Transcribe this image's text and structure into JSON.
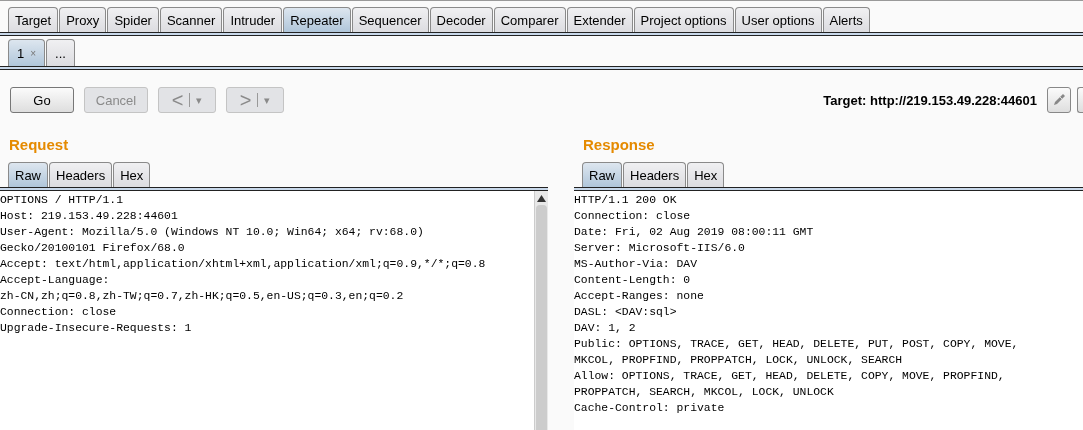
{
  "main_tabs": [
    {
      "label": "Target",
      "selected": false
    },
    {
      "label": "Proxy",
      "selected": false
    },
    {
      "label": "Spider",
      "selected": false
    },
    {
      "label": "Scanner",
      "selected": false
    },
    {
      "label": "Intruder",
      "selected": false
    },
    {
      "label": "Repeater",
      "selected": true
    },
    {
      "label": "Sequencer",
      "selected": false
    },
    {
      "label": "Decoder",
      "selected": false
    },
    {
      "label": "Comparer",
      "selected": false
    },
    {
      "label": "Extender",
      "selected": false
    },
    {
      "label": "Project options",
      "selected": false
    },
    {
      "label": "User options",
      "selected": false
    },
    {
      "label": "Alerts",
      "selected": false
    }
  ],
  "repeater_tabs": [
    {
      "label": "1",
      "close": "×",
      "selected": true
    },
    {
      "label": "...",
      "selected": false
    }
  ],
  "toolbar": {
    "buttons": [
      {
        "kind": "text",
        "label": "Go",
        "disabled": false
      },
      {
        "kind": "text",
        "label": "Cancel",
        "disabled": true
      },
      {
        "kind": "back",
        "label": "<",
        "menu": "▾",
        "disabled": true
      },
      {
        "kind": "forward",
        "label": ">",
        "menu": "▾",
        "disabled": true
      }
    ],
    "target": "Target: http://219.153.49.228:44601"
  },
  "request": {
    "title": "Request",
    "tabs": [
      {
        "label": "Raw",
        "selected": true
      },
      {
        "label": "Headers",
        "selected": false
      },
      {
        "label": "Hex",
        "selected": false
      }
    ],
    "lines": [
      "OPTIONS / HTTP/1.1",
      "Host: 219.153.49.228:44601",
      "User-Agent: Mozilla/5.0 (Windows NT 10.0; Win64; x64; rv:68.0)",
      "Gecko/20100101 Firefox/68.0",
      "Accept: text/html,application/xhtml+xml,application/xml;q=0.9,*/*;q=0.8",
      "Accept-Language:",
      "zh-CN,zh;q=0.8,zh-TW;q=0.7,zh-HK;q=0.5,en-US;q=0.3,en;q=0.2",
      "Connection: close",
      "Upgrade-Insecure-Requests: 1"
    ]
  },
  "response": {
    "title": "Response",
    "tabs": [
      {
        "label": "Raw",
        "selected": true
      },
      {
        "label": "Headers",
        "selected": false
      },
      {
        "label": "Hex",
        "selected": false
      }
    ],
    "lines": [
      "HTTP/1.1 200 OK",
      "Connection: close",
      "Date: Fri, 02 Aug 2019 08:00:11 GMT",
      "Server: Microsoft-IIS/6.0",
      "MS-Author-Via: DAV",
      "Content-Length: 0",
      "Accept-Ranges: none",
      "DASL: <DAV:sql>",
      "DAV: 1, 2",
      "Public: OPTIONS, TRACE, GET, HEAD, DELETE, PUT, POST, COPY, MOVE,",
      "MKCOL, PROPFIND, PROPPATCH, LOCK, UNLOCK, SEARCH",
      "Allow: OPTIONS, TRACE, GET, HEAD, DELETE, COPY, MOVE, PROPFIND,",
      "PROPPATCH, SEARCH, MKCOL, LOCK, UNLOCK",
      "Cache-Control: private"
    ]
  }
}
